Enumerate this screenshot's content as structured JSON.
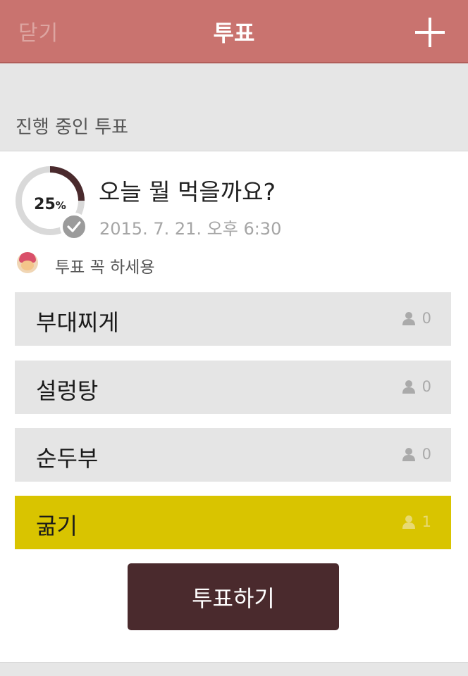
{
  "header": {
    "close_label": "닫기",
    "title": "투표",
    "add_icon": "plus-icon"
  },
  "section_label": "진행 중인 투표",
  "poll": {
    "progress_percent": 25,
    "progress_number": "25",
    "progress_unit": "%",
    "status_icon": "check-icon",
    "title": "오늘 뭘 먹을까요?",
    "date": "2015. 7. 21. 오후 6:30",
    "creator_message": "투표 꼭 하세용",
    "options": [
      {
        "label": "부대찌게",
        "votes": "0",
        "selected": false
      },
      {
        "label": "설렁탕",
        "votes": "0",
        "selected": false
      },
      {
        "label": "순두부",
        "votes": "0",
        "selected": false
      },
      {
        "label": "굶기",
        "votes": "1",
        "selected": true
      }
    ],
    "vote_button_label": "투표하기"
  },
  "colors": {
    "header_bg": "#c9736f",
    "accent_dark": "#4a2a2d",
    "selected_option": "#d9c400"
  }
}
